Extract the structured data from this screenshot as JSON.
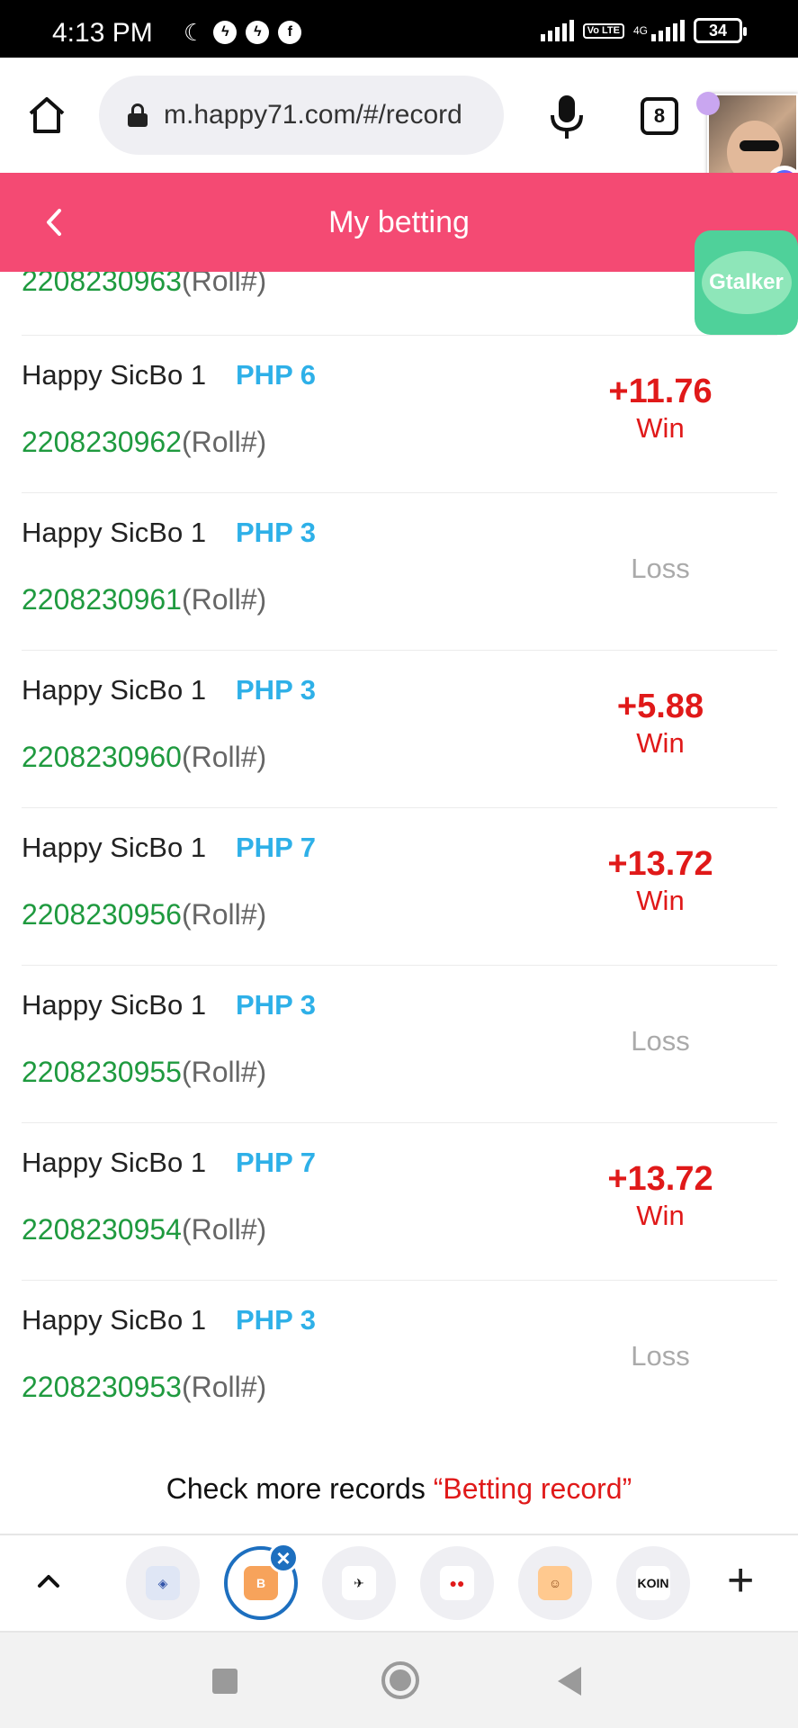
{
  "status_bar": {
    "time": "4:13 PM",
    "left_icons": [
      "moon-icon",
      "messenger-icon",
      "messenger-icon",
      "facebook-icon"
    ],
    "volte": "Vo LTE",
    "network": "4G",
    "battery": "34"
  },
  "browser": {
    "url": "m.happy71.com/#/record",
    "tab_count": "8"
  },
  "overlays": {
    "gtalker_label": "Gtalker"
  },
  "header": {
    "title": "My betting"
  },
  "partial_roll": {
    "number": "2208230963",
    "suffix": "(Roll#)"
  },
  "records": [
    {
      "game": "Happy SicBo 1",
      "amount": "PHP 6",
      "roll": "2208230962",
      "suffix": "(Roll#)",
      "value": "+11.76",
      "result": "Win"
    },
    {
      "game": "Happy SicBo 1",
      "amount": "PHP 3",
      "roll": "2208230961",
      "suffix": "(Roll#)",
      "value": "",
      "result": "Loss"
    },
    {
      "game": "Happy SicBo 1",
      "amount": "PHP 3",
      "roll": "2208230960",
      "suffix": "(Roll#)",
      "value": "+5.88",
      "result": "Win"
    },
    {
      "game": "Happy SicBo 1",
      "amount": "PHP 7",
      "roll": "2208230956",
      "suffix": "(Roll#)",
      "value": "+13.72",
      "result": "Win"
    },
    {
      "game": "Happy SicBo 1",
      "amount": "PHP 3",
      "roll": "2208230955",
      "suffix": "(Roll#)",
      "value": "",
      "result": "Loss"
    },
    {
      "game": "Happy SicBo 1",
      "amount": "PHP 7",
      "roll": "2208230954",
      "suffix": "(Roll#)",
      "value": "+13.72",
      "result": "Win"
    },
    {
      "game": "Happy SicBo 1",
      "amount": "PHP 3",
      "roll": "2208230953",
      "suffix": "(Roll#)",
      "value": "",
      "result": "Loss"
    }
  ],
  "footer": {
    "prefix": "Check more records ",
    "link": "“Betting record”"
  },
  "tab_strip": {
    "tabs": [
      {
        "icon": "shield-app-icon",
        "label": "◈"
      },
      {
        "icon": "happy71-app-icon",
        "label": "B"
      },
      {
        "icon": "drone-app-icon",
        "label": "✈"
      },
      {
        "icon": "video-app-icon",
        "label": "●●"
      },
      {
        "icon": "avatar-app-icon",
        "label": "☺"
      },
      {
        "icon": "koin-app-icon",
        "label": "KOIN"
      }
    ],
    "close_label": "×",
    "plus_label": "+"
  },
  "colors": {
    "header": "#f44a73",
    "win": "#e01919",
    "roll": "#1f9a3f",
    "amount": "#2eb0e8",
    "loss": "#aaaaaa"
  }
}
